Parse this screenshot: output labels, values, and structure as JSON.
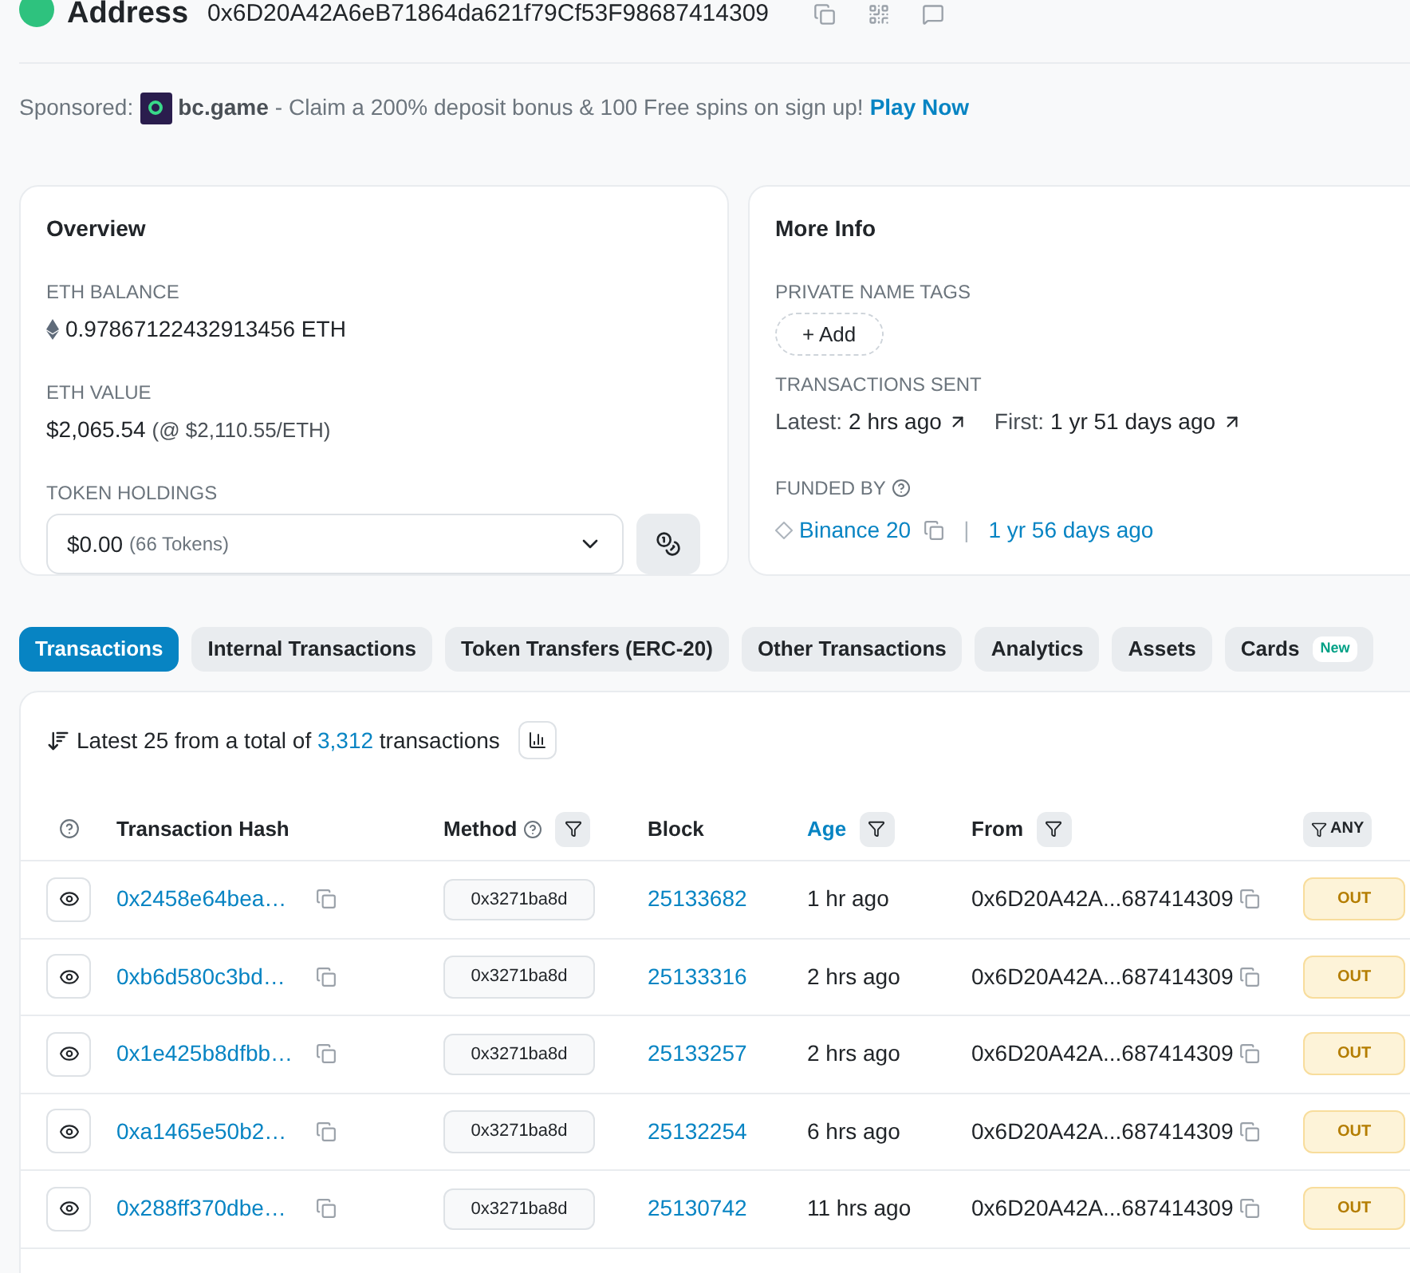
{
  "header": {
    "title": "Address",
    "address": "0x6D20A42A6eB71864da621f79Cf53F98687414309"
  },
  "sponsor": {
    "label": "Sponsored:",
    "brand": "bc.game",
    "message": "- Claim a 200% deposit bonus & 100 Free spins on sign up!",
    "link": "Play Now"
  },
  "overview": {
    "title": "Overview",
    "balance_label": "ETH BALANCE",
    "balance": "0.97867122432913456 ETH",
    "value_label": "ETH VALUE",
    "value": "$2,065.54",
    "value_rate": "(@ $2,110.55/ETH)",
    "holdings_label": "TOKEN HOLDINGS",
    "holdings_value": "$0.00",
    "holdings_count": "(66 Tokens)"
  },
  "more_info": {
    "title": "More Info",
    "tags_label": "PRIVATE NAME TAGS",
    "add_button": "+ Add",
    "sent_label": "TRANSACTIONS SENT",
    "latest_label": "Latest:",
    "latest": "2 hrs ago",
    "first_label": "First:",
    "first": "1 yr 51 days ago",
    "funded_label": "FUNDED BY",
    "funded_by": "Binance 20",
    "separator": "|",
    "funded_age": "1 yr 56 days ago"
  },
  "tabs": [
    {
      "label": "Transactions",
      "selected": true
    },
    {
      "label": "Internal Transactions",
      "selected": false
    },
    {
      "label": "Token Transfers (ERC-20)",
      "selected": false
    },
    {
      "label": "Other Transactions",
      "selected": false
    },
    {
      "label": "Analytics",
      "selected": false
    },
    {
      "label": "Assets",
      "selected": false
    },
    {
      "label": "Cards",
      "selected": false,
      "badge": "New"
    }
  ],
  "summary": {
    "prefix": "Latest 25 from a total of",
    "count": "3,312",
    "suffix": "transactions"
  },
  "table": {
    "columns": [
      {
        "label": "Transaction Hash",
        "help": false,
        "filter": false,
        "sorted": false
      },
      {
        "label": "Method",
        "help": true,
        "filter": true,
        "sorted": false
      },
      {
        "label": "Block",
        "help": false,
        "filter": false,
        "sorted": false
      },
      {
        "label": "Age",
        "help": false,
        "filter": true,
        "sorted": true
      },
      {
        "label": "From",
        "help": false,
        "filter": true,
        "sorted": false
      }
    ],
    "direction_filter": "ANY",
    "rows": [
      {
        "hash": "0x2458e64bea…",
        "method": "0x3271ba8d",
        "block": "25133682",
        "age": "1 hr ago",
        "from": "0x6D20A42A...687414309",
        "direction": "OUT"
      },
      {
        "hash": "0xb6d580c3bd…",
        "method": "0x3271ba8d",
        "block": "25133316",
        "age": "2 hrs ago",
        "from": "0x6D20A42A...687414309",
        "direction": "OUT"
      },
      {
        "hash": "0x1e425b8dfbb…",
        "method": "0x3271ba8d",
        "block": "25133257",
        "age": "2 hrs ago",
        "from": "0x6D20A42A...687414309",
        "direction": "OUT"
      },
      {
        "hash": "0xa1465e50b2…",
        "method": "0x3271ba8d",
        "block": "25132254",
        "age": "6 hrs ago",
        "from": "0x6D20A42A...687414309",
        "direction": "OUT"
      },
      {
        "hash": "0x288ff370dbe…",
        "method": "0x3271ba8d",
        "block": "25130742",
        "age": "11 hrs ago",
        "from": "0x6D20A42A...687414309",
        "direction": "OUT"
      }
    ]
  }
}
